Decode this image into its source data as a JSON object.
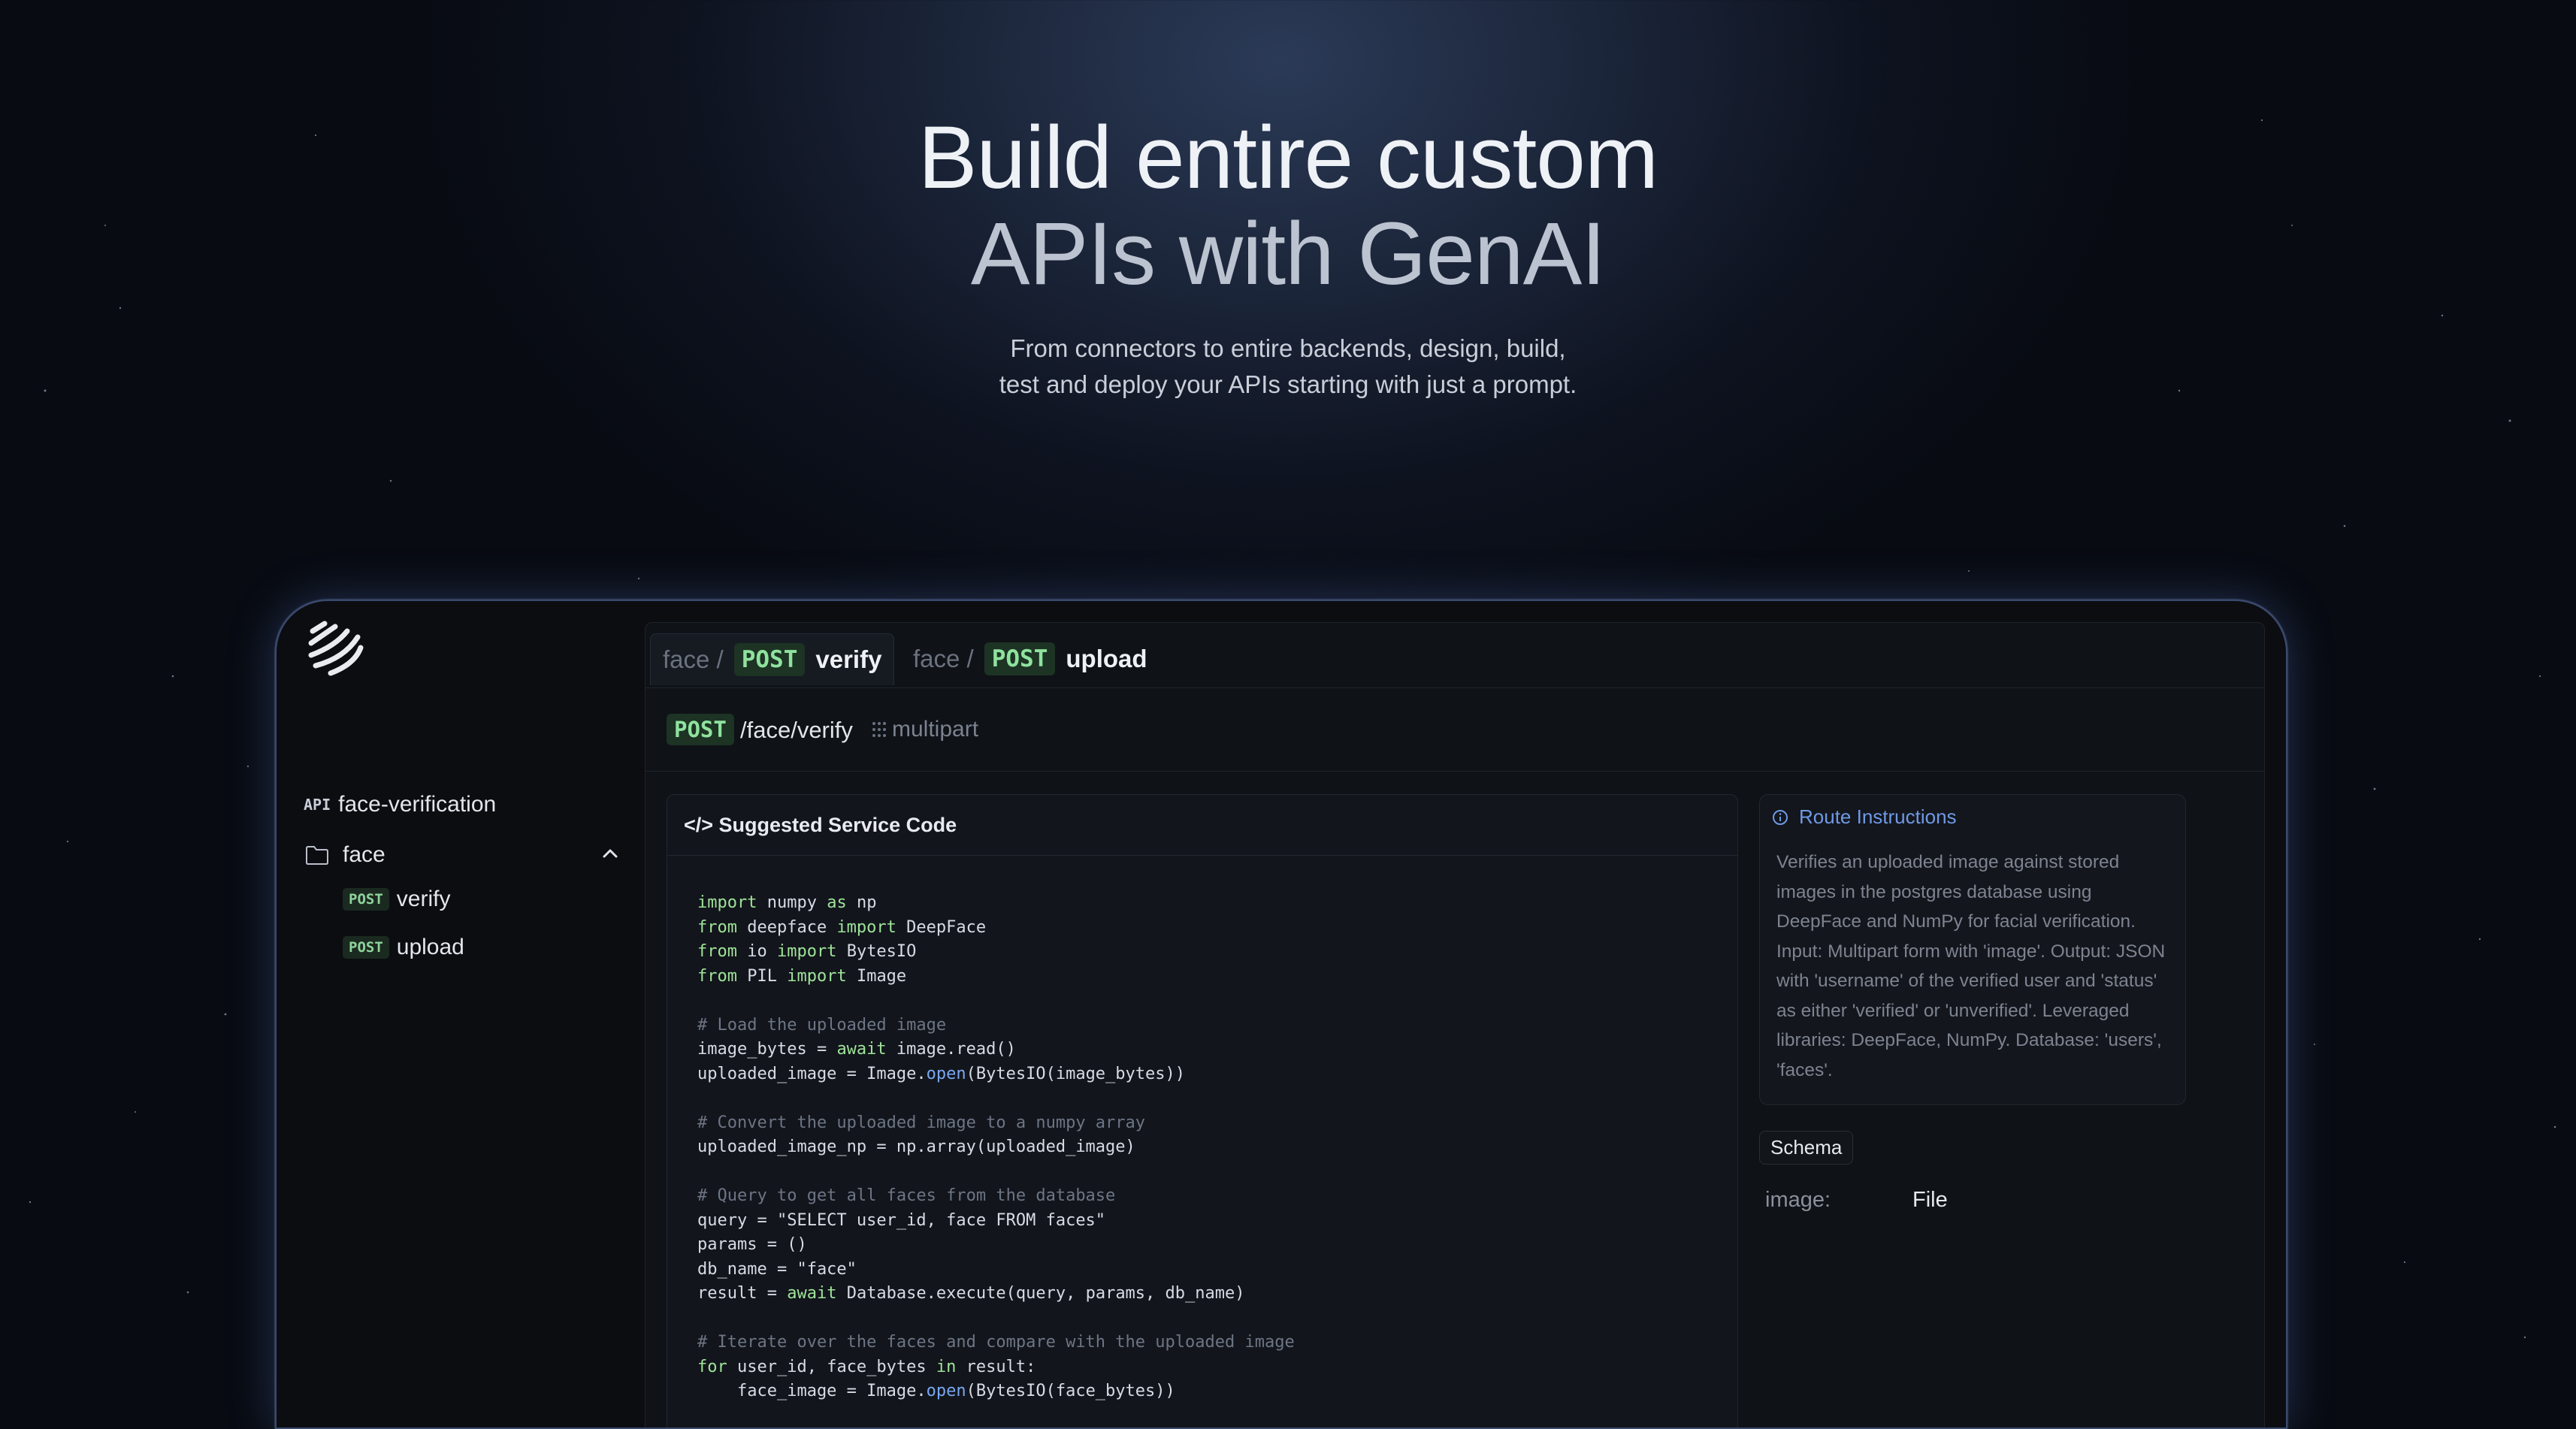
{
  "hero": {
    "title_line1": "Build entire custom",
    "title_line2": "APIs with GenAI",
    "subtitle_line1": "From connectors to entire backends, design, build,",
    "subtitle_line2": "test and deploy your APIs starting with just a prompt."
  },
  "sidebar": {
    "api_tag": "API",
    "api_name": "face-verification",
    "folder": "face",
    "routes": [
      {
        "method": "POST",
        "name": "verify"
      },
      {
        "method": "POST",
        "name": "upload"
      }
    ]
  },
  "tabs": [
    {
      "crumb": "face /",
      "method": "POST",
      "name": "verify"
    },
    {
      "crumb": "face /",
      "method": "POST",
      "name": "upload"
    }
  ],
  "route": {
    "method": "POST",
    "path": "/face/verify",
    "content_type": "multipart"
  },
  "code_panel": {
    "title": "</> Suggested Service Code"
  },
  "instructions": {
    "title": "Route Instructions",
    "body": "Verifies an uploaded image against stored images in the postgres database using DeepFace and NumPy for facial verification. Input: Multipart form with 'image'. Output: JSON with 'username' of the verified user and 'status' as either 'verified' or 'unverified'. Leveraged libraries: DeepFace, NumPy. Database: 'users', 'faces'."
  },
  "schema": {
    "label": "Schema",
    "fields": [
      {
        "key": "image:",
        "type": "File"
      }
    ]
  }
}
